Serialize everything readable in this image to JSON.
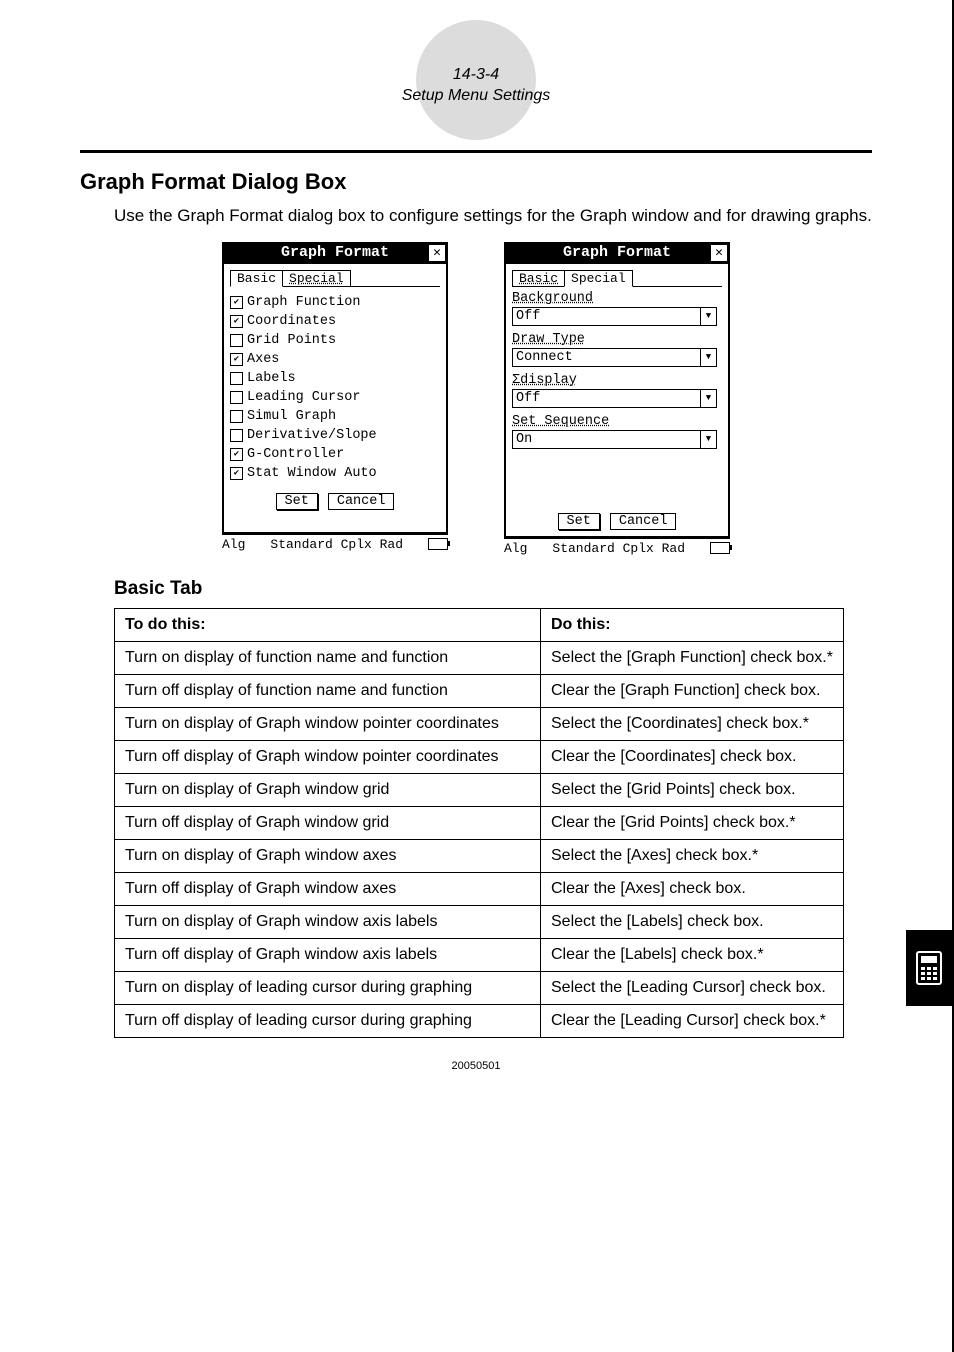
{
  "header": {
    "page_code": "14-3-4",
    "section": "Setup Menu Settings"
  },
  "title": "Graph Format Dialog Box",
  "intro": "Use the Graph Format dialog box to configure settings for the Graph window and for drawing graphs.",
  "dialog_basic": {
    "title": "Graph Format",
    "tabs": {
      "basic": "Basic",
      "special": "Special"
    },
    "items": [
      {
        "label": "Graph Function",
        "checked": true
      },
      {
        "label": "Coordinates",
        "checked": true
      },
      {
        "label": "Grid Points",
        "checked": false
      },
      {
        "label": "Axes",
        "checked": true
      },
      {
        "label": "Labels",
        "checked": false
      },
      {
        "label": "Leading Cursor",
        "checked": false
      },
      {
        "label": "Simul Graph",
        "checked": false
      },
      {
        "label": "Derivative/Slope",
        "checked": false
      },
      {
        "label": "G-Controller",
        "checked": true
      },
      {
        "label": "Stat Window Auto",
        "checked": true
      }
    ],
    "buttons": {
      "set": "Set",
      "cancel": "Cancel"
    },
    "status": {
      "left": "Alg",
      "mid": "Standard Cplx Rad"
    }
  },
  "dialog_special": {
    "title": "Graph Format",
    "tabs": {
      "basic": "Basic",
      "special": "Special"
    },
    "fields": [
      {
        "label": "Background",
        "value": "Off"
      },
      {
        "label": "Draw Type",
        "value": "Connect"
      },
      {
        "label": "Σdisplay",
        "value": "Off"
      },
      {
        "label": "Set Sequence",
        "value": "On"
      }
    ],
    "buttons": {
      "set": "Set",
      "cancel": "Cancel"
    },
    "status": {
      "left": "Alg",
      "mid": "Standard Cplx Rad"
    }
  },
  "subheading": "Basic Tab",
  "table": {
    "headers": {
      "col1": "To do this:",
      "col2": "Do this:"
    },
    "rows": [
      {
        "todo": "Turn on display of function name and function",
        "dothis": "Select the [Graph Function] check box.*"
      },
      {
        "todo": "Turn off display of function name and function",
        "dothis": "Clear the [Graph Function] check box."
      },
      {
        "todo": "Turn on display of Graph window pointer coordinates",
        "dothis": "Select the [Coordinates] check box.*"
      },
      {
        "todo": "Turn off display of Graph window pointer coordinates",
        "dothis": "Clear the [Coordinates] check box."
      },
      {
        "todo": "Turn on display of Graph window grid",
        "dothis": "Select the [Grid Points] check box."
      },
      {
        "todo": "Turn off display of Graph window grid",
        "dothis": "Clear the [Grid Points] check box.*"
      },
      {
        "todo": "Turn on display of Graph window axes",
        "dothis": "Select the [Axes] check box.*"
      },
      {
        "todo": "Turn off display of Graph window axes",
        "dothis": "Clear the [Axes] check box."
      },
      {
        "todo": "Turn on display of Graph window axis labels",
        "dothis": "Select the [Labels] check box."
      },
      {
        "todo": "Turn off display of Graph window axis labels",
        "dothis": "Clear the [Labels] check box.*"
      },
      {
        "todo": "Turn on display of leading cursor during graphing",
        "dothis": "Select the [Leading Cursor] check box."
      },
      {
        "todo": "Turn off display of leading cursor during graphing",
        "dothis": "Clear the [Leading Cursor] check box.*"
      }
    ]
  },
  "footer_code": "20050501"
}
